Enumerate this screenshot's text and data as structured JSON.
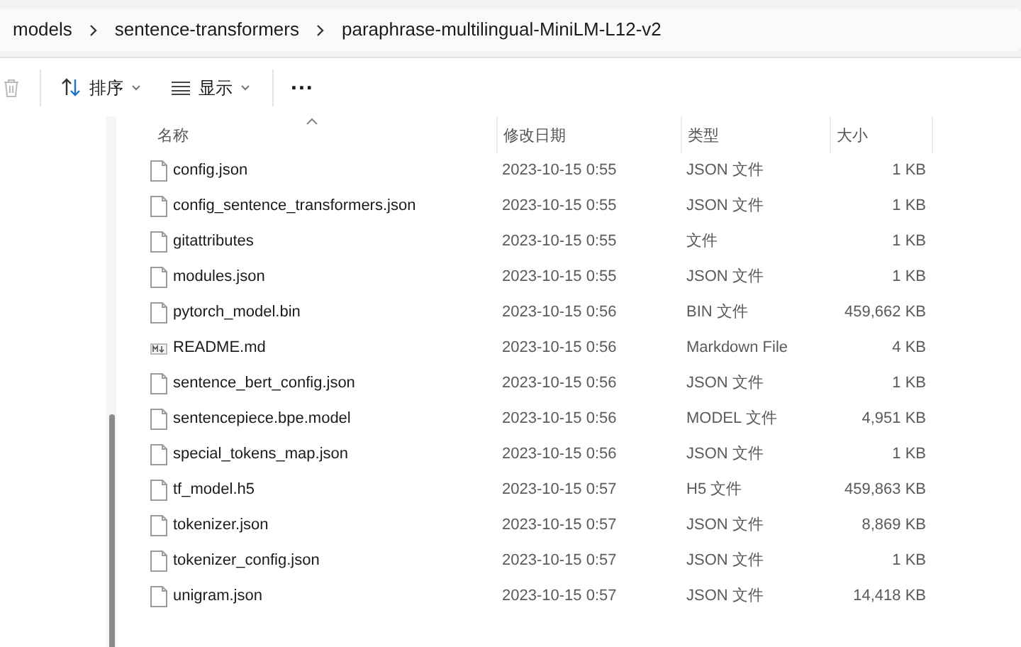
{
  "breadcrumb": [
    "models",
    "sentence-transformers",
    "paraphrase-multilingual-MiniLM-L12-v2"
  ],
  "toolbar": {
    "sort": "排序",
    "view": "显示",
    "more": "..."
  },
  "table": {
    "columns": [
      {
        "label": "名称",
        "sorted": true
      },
      {
        "label": "修改日期",
        "sorted": false
      },
      {
        "label": "类型",
        "sorted": false
      },
      {
        "label": "大小",
        "sorted": false
      }
    ],
    "rows": [
      {
        "kind": "file",
        "name": "config.json",
        "date": "2023-10-15 0:55",
        "type": "JSON 文件",
        "size": "1 KB"
      },
      {
        "kind": "file",
        "name": "config_sentence_transformers.json",
        "date": "2023-10-15 0:55",
        "type": "JSON 文件",
        "size": "1 KB"
      },
      {
        "kind": "file",
        "name": "gitattributes",
        "date": "2023-10-15 0:55",
        "type": "文件",
        "size": "1 KB"
      },
      {
        "kind": "file",
        "name": "modules.json",
        "date": "2023-10-15 0:55",
        "type": "JSON 文件",
        "size": "1 KB"
      },
      {
        "kind": "file",
        "name": "pytorch_model.bin",
        "date": "2023-10-15 0:56",
        "type": "BIN 文件",
        "size": "459,662 KB"
      },
      {
        "kind": "markdown",
        "name": "README.md",
        "date": "2023-10-15 0:56",
        "type": "Markdown File",
        "size": "4 KB"
      },
      {
        "kind": "file",
        "name": "sentence_bert_config.json",
        "date": "2023-10-15 0:56",
        "type": "JSON 文件",
        "size": "1 KB"
      },
      {
        "kind": "file",
        "name": "sentencepiece.bpe.model",
        "date": "2023-10-15 0:56",
        "type": "MODEL 文件",
        "size": "4,951 KB"
      },
      {
        "kind": "file",
        "name": "special_tokens_map.json",
        "date": "2023-10-15 0:56",
        "type": "JSON 文件",
        "size": "1 KB"
      },
      {
        "kind": "file",
        "name": "tf_model.h5",
        "date": "2023-10-15 0:57",
        "type": "H5 文件",
        "size": "459,863 KB"
      },
      {
        "kind": "file",
        "name": "tokenizer.json",
        "date": "2023-10-15 0:57",
        "type": "JSON 文件",
        "size": "8,869 KB"
      },
      {
        "kind": "file",
        "name": "tokenizer_config.json",
        "date": "2023-10-15 0:57",
        "type": "JSON 文件",
        "size": "1 KB"
      },
      {
        "kind": "file",
        "name": "unigram.json",
        "date": "2023-10-15 0:57",
        "type": "JSON 文件",
        "size": "14,418 KB"
      }
    ]
  }
}
